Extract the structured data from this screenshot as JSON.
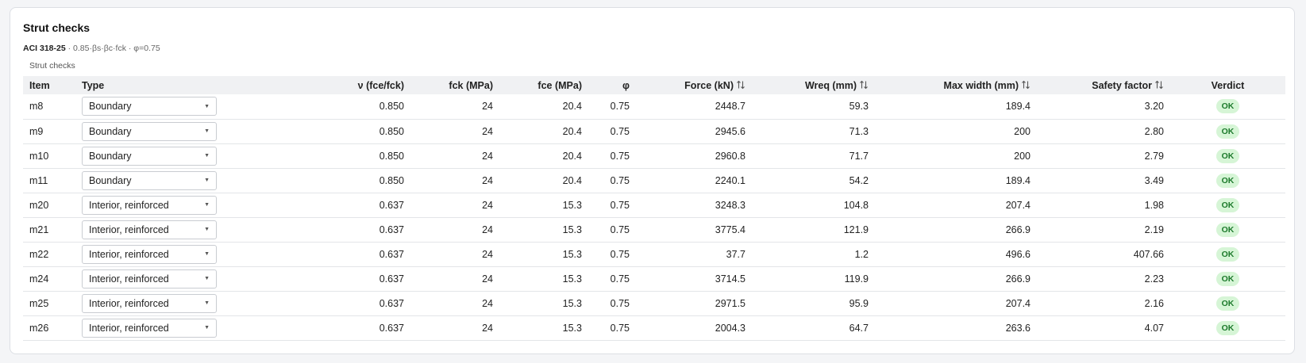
{
  "panel": {
    "title": "Strut checks",
    "standard": "ACI 318-25",
    "formula": " · 0.85·βs·βc·fck · φ=0.75",
    "caption": "Strut checks"
  },
  "table": {
    "columns": {
      "item": "Item",
      "type": "Type",
      "nu": "ν (fce/fck)",
      "fck": "fck (MPa)",
      "fce": "fce (MPa)",
      "phi": "φ",
      "force": "Force (kN)",
      "wreq": "Wreq (mm)",
      "maxw": "Max width (mm)",
      "sf": "Safety factor",
      "verdict": "Verdict"
    },
    "sortable_icon": "sort-arrows-icon",
    "rows": [
      {
        "item": "m8",
        "type": "Boundary",
        "nu": "0.850",
        "fck": "24",
        "fce": "20.4",
        "phi": "0.75",
        "force": "2448.7",
        "wreq": "59.3",
        "maxw": "189.4",
        "sf": "3.20",
        "verdict": "OK"
      },
      {
        "item": "m9",
        "type": "Boundary",
        "nu": "0.850",
        "fck": "24",
        "fce": "20.4",
        "phi": "0.75",
        "force": "2945.6",
        "wreq": "71.3",
        "maxw": "200",
        "sf": "2.80",
        "verdict": "OK"
      },
      {
        "item": "m10",
        "type": "Boundary",
        "nu": "0.850",
        "fck": "24",
        "fce": "20.4",
        "phi": "0.75",
        "force": "2960.8",
        "wreq": "71.7",
        "maxw": "200",
        "sf": "2.79",
        "verdict": "OK"
      },
      {
        "item": "m11",
        "type": "Boundary",
        "nu": "0.850",
        "fck": "24",
        "fce": "20.4",
        "phi": "0.75",
        "force": "2240.1",
        "wreq": "54.2",
        "maxw": "189.4",
        "sf": "3.49",
        "verdict": "OK"
      },
      {
        "item": "m20",
        "type": "Interior, reinforced",
        "nu": "0.637",
        "fck": "24",
        "fce": "15.3",
        "phi": "0.75",
        "force": "3248.3",
        "wreq": "104.8",
        "maxw": "207.4",
        "sf": "1.98",
        "verdict": "OK"
      },
      {
        "item": "m21",
        "type": "Interior, reinforced",
        "nu": "0.637",
        "fck": "24",
        "fce": "15.3",
        "phi": "0.75",
        "force": "3775.4",
        "wreq": "121.9",
        "maxw": "266.9",
        "sf": "2.19",
        "verdict": "OK"
      },
      {
        "item": "m22",
        "type": "Interior, reinforced",
        "nu": "0.637",
        "fck": "24",
        "fce": "15.3",
        "phi": "0.75",
        "force": "37.7",
        "wreq": "1.2",
        "maxw": "496.6",
        "sf": "407.66",
        "verdict": "OK"
      },
      {
        "item": "m24",
        "type": "Interior, reinforced",
        "nu": "0.637",
        "fck": "24",
        "fce": "15.3",
        "phi": "0.75",
        "force": "3714.5",
        "wreq": "119.9",
        "maxw": "266.9",
        "sf": "2.23",
        "verdict": "OK"
      },
      {
        "item": "m25",
        "type": "Interior, reinforced",
        "nu": "0.637",
        "fck": "24",
        "fce": "15.3",
        "phi": "0.75",
        "force": "2971.5",
        "wreq": "95.9",
        "maxw": "207.4",
        "sf": "2.16",
        "verdict": "OK"
      },
      {
        "item": "m26",
        "type": "Interior, reinforced",
        "nu": "0.637",
        "fck": "24",
        "fce": "15.3",
        "phi": "0.75",
        "force": "2004.3",
        "wreq": "64.7",
        "maxw": "263.6",
        "sf": "4.07",
        "verdict": "OK"
      }
    ]
  },
  "colors": {
    "ok_badge_bg": "#d6f5d6",
    "ok_badge_text": "#1d7a2c",
    "header_bg": "#f0f1f3"
  }
}
